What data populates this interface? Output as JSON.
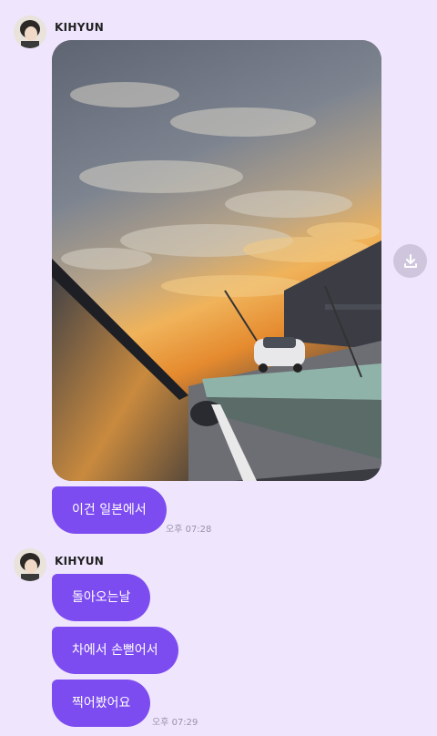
{
  "messages": [
    {
      "sender": "KIHYUN",
      "image_alt": "sunset highway photo",
      "bubbles": [
        "이건 일본에서"
      ],
      "time": "오후 07:28"
    },
    {
      "sender": "KIHYUN",
      "bubbles": [
        "돌아오는날",
        "차에서 손뻗어서",
        "찍어봤어요"
      ],
      "time": "오후 07:29"
    }
  ],
  "icons": {
    "download": "download-icon",
    "avatar": "avatar"
  },
  "colors": {
    "background": "#efe6fd",
    "bubble": "#7d4cf0",
    "bubble_text": "#ffffff",
    "time_text": "#9a93a8"
  }
}
